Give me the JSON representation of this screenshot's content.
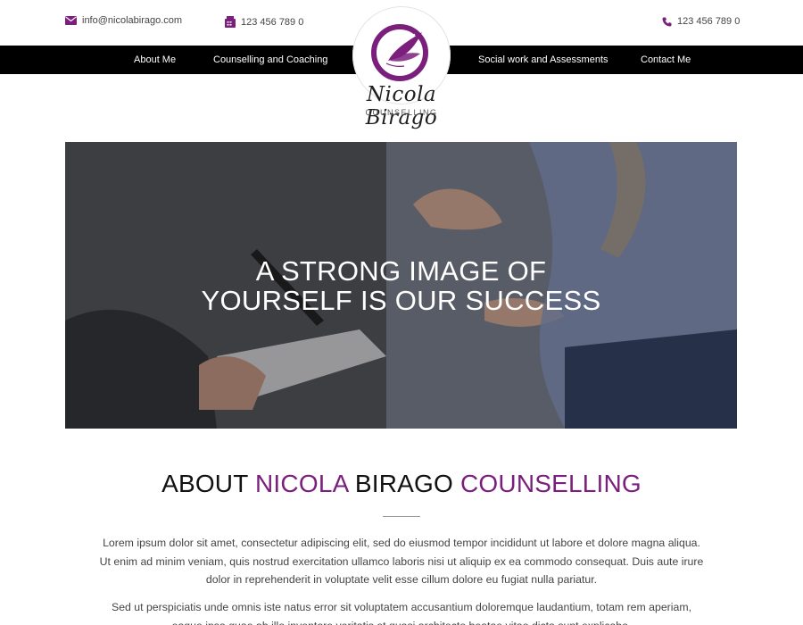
{
  "contact": {
    "email": "info@nicolabirago.com",
    "fax": "123 456 789 0",
    "phone": "123 456 789 0"
  },
  "nav": {
    "items": [
      {
        "label": "About Me"
      },
      {
        "label": "Counselling and Coaching"
      },
      {
        "label": "Social work and Assessments"
      },
      {
        "label": "Contact Me"
      }
    ]
  },
  "logo": {
    "name": "Nicola Birago",
    "subtitle": "COUNSELLING"
  },
  "hero": {
    "line1": "A STRONG IMAGE OF",
    "line2": "YOURSELF IS OUR SUCCESS"
  },
  "about": {
    "title_part1": "ABOUT ",
    "title_accent1": "NICOLA",
    "title_part2": " BIRAGO ",
    "title_accent2": "COUNSELLING",
    "paragraph1": "Lorem ipsum dolor sit amet, consectetur adipiscing elit, sed do eiusmod tempor incididunt ut labore et dolore magna aliqua. Ut enim ad minim veniam, quis nostrud exercitation ullamco laboris nisi ut aliquip ex ea commodo consequat. Duis aute irure dolor in reprehenderit in voluptate velit esse cillum dolore eu fugiat nulla pariatur.",
    "paragraph2": "Sed ut perspiciatis unde omnis iste natus error sit voluptatem accusantium doloremque laudantium, totam rem aperiam, eaque ipsa quae ab illo inventore veritatis et quasi architecto beatae vitae dicta sunt explicabo."
  },
  "colors": {
    "accent": "#7b1f7d",
    "navbar": "#000000",
    "text": "#444444"
  },
  "icons": {
    "email": "envelope-icon",
    "fax": "fax-icon",
    "phone": "phone-icon",
    "logo": "butterfly-logo-icon"
  }
}
